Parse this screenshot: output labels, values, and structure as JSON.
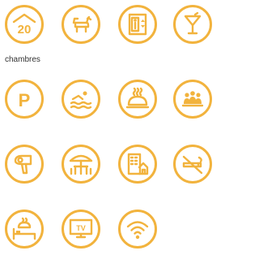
{
  "caption": "chambres",
  "rooms_count": "20",
  "parking_letter": "P",
  "tv_label": "TV",
  "accent_color": "#f2b33d",
  "icons": [
    "rooms-count-icon",
    "pets-icon",
    "elevator-icon",
    "bar-icon",
    "parking-icon",
    "pool-icon",
    "room-service-icon",
    "meeting-room-icon",
    "hair-dryer-icon",
    "terrace-icon",
    "building-icon",
    "no-smoking-icon",
    "breakfast-in-bed-icon",
    "tv-icon",
    "wifi-icon"
  ]
}
